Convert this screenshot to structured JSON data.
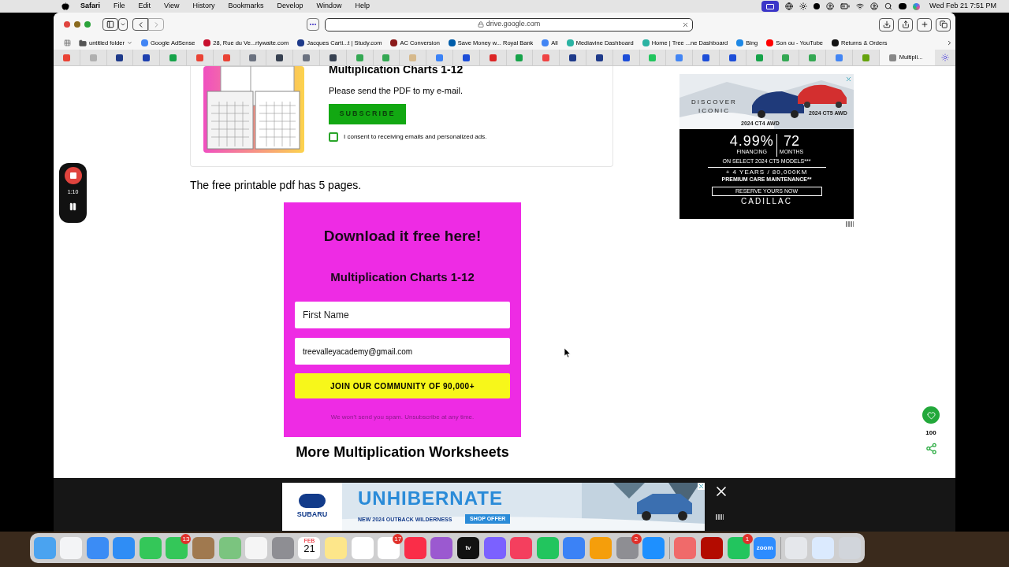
{
  "menu_bar": {
    "app": "Safari",
    "items": [
      "File",
      "Edit",
      "View",
      "History",
      "Bookmarks",
      "Develop",
      "Window",
      "Help"
    ],
    "clock": "Wed Feb 21  7:51 PM"
  },
  "toolbar": {
    "address": "drive.google.com"
  },
  "bookmarks": [
    {
      "label": "untitled folder",
      "kind": "folder",
      "color": "#555555"
    },
    {
      "label": "Google AdSense",
      "kind": "site",
      "color": "#4285f4"
    },
    {
      "label": "28, Rue du Ve...rtywaite.com",
      "kind": "site",
      "color": "#c8102e"
    },
    {
      "label": "Jacques Carti...t | Study.com",
      "kind": "site",
      "color": "#1e3a8a"
    },
    {
      "label": "AC Conversion",
      "kind": "site",
      "color": "#8b1a1a"
    },
    {
      "label": "Save Money w... Royal Bank",
      "kind": "site",
      "color": "#005daa"
    },
    {
      "label": "All",
      "kind": "site",
      "color": "#4285f4"
    },
    {
      "label": "Mediavine Dashboard",
      "kind": "site",
      "color": "#2bb3a3"
    },
    {
      "label": "Home | Tree ...ne Dashboard",
      "kind": "site",
      "color": "#2bb3a3"
    },
    {
      "label": "Bing",
      "kind": "site",
      "color": "#1e88e5"
    },
    {
      "label": "Son ou - YouTube",
      "kind": "site",
      "color": "#ff0000"
    },
    {
      "label": "Returns & Orders",
      "kind": "site",
      "color": "#111111"
    }
  ],
  "pinned_tabs": [
    {
      "color": "#ea4335"
    },
    {
      "color": "#b0b0b0"
    },
    {
      "color": "#1e3a8a"
    },
    {
      "color": "#1e40af"
    },
    {
      "color": "#16a34a"
    },
    {
      "color": "#ea4335"
    },
    {
      "color": "#ea4335"
    },
    {
      "color": "#6b7280"
    },
    {
      "color": "#374151"
    },
    {
      "color": "#6b7280"
    },
    {
      "color": "#374151"
    },
    {
      "color": "#34a853"
    },
    {
      "color": "#34a853"
    },
    {
      "color": "#d6b98c"
    },
    {
      "color": "#3b82f6"
    },
    {
      "color": "#1d4ed8"
    },
    {
      "color": "#dc2626"
    },
    {
      "color": "#16a34a"
    },
    {
      "color": "#ef4444"
    },
    {
      "color": "#1e3a8a"
    },
    {
      "color": "#1e3a8a"
    },
    {
      "color": "#1d4ed8"
    },
    {
      "color": "#22c55e"
    },
    {
      "color": "#4285f4"
    },
    {
      "color": "#1d4ed8"
    },
    {
      "color": "#1d4ed8"
    },
    {
      "color": "#16a34a"
    },
    {
      "color": "#34a853"
    },
    {
      "color": "#34a853"
    },
    {
      "color": "#4285f4"
    },
    {
      "color": "#65a30d"
    }
  ],
  "active_tab": {
    "label": "Multipli...",
    "selected": true
  },
  "recorder": {
    "time": "1:10"
  },
  "optin_card": {
    "title": "Multiplication Charts 1-12",
    "text": "Please send the PDF to my e-mail.",
    "button": "SUBSCRIBE",
    "consent": {
      "label": "I consent to receiving emails and personalized ads.",
      "checked": false
    }
  },
  "paragraph": "The free printable pdf has 5 pages.",
  "download_box": {
    "title": "Download it free here!",
    "subtitle": "Multiplication Charts 1-12",
    "name_field": {
      "placeholder": "First Name"
    },
    "email_field": {
      "value": "treevalleyacademy@gmail.com"
    },
    "button": "JOIN OUR COMMUNITY OF 90,000+",
    "note": "We won't send you spam. Unsubscribe at any time."
  },
  "section_heading": "More Multiplication Worksheets",
  "side_ad": {
    "headline": "DISCOVER ICONIC",
    "car_1": "2024 CT4 AWD",
    "car_2": "2024 CT5 AWD",
    "rate": "4.99%",
    "rate_label": "FINANCING",
    "term": "72",
    "term_label": "MONTHS",
    "fine_print": "ON SELECT 2024 CT5 MODELS***",
    "offer": "+ 4 YEARS / 80,000KM",
    "offer_sub": "PREMIUM CARE MAINTENANCE**",
    "cta": "RESERVE YOURS NOW",
    "brand": "CADILLAC"
  },
  "share": {
    "count": "100"
  },
  "bottom_ad": {
    "brand": "SUBARU",
    "headline": "UNHIBERNATE",
    "tagline": "NEW 2024 OUTBACK WILDERNESS",
    "cta": "SHOP OFFER"
  },
  "dock": [
    {
      "kind": "app",
      "color": "#4aa3f0"
    },
    {
      "kind": "app",
      "color": "#f3f4f6"
    },
    {
      "kind": "app",
      "color": "#3b8cf5"
    },
    {
      "kind": "app",
      "color": "#2f8df5"
    },
    {
      "kind": "app",
      "color": "#34c759"
    },
    {
      "kind": "app",
      "color": "#34c759",
      "badge": "13"
    },
    {
      "kind": "app",
      "color": "#a0794f"
    },
    {
      "kind": "app",
      "color": "#7bc47f"
    },
    {
      "kind": "app",
      "color": "#f5f5f5"
    },
    {
      "kind": "app",
      "color": "#8e8e93"
    },
    {
      "kind": "calendar",
      "month": "FEB",
      "day": "21"
    },
    {
      "kind": "app",
      "color": "#fde68a"
    },
    {
      "kind": "app",
      "color": "#ffffff"
    },
    {
      "kind": "app",
      "color": "#ffffff",
      "badge": "17"
    },
    {
      "kind": "app",
      "color": "#fa2d48"
    },
    {
      "kind": "app",
      "color": "#9b59d0"
    },
    {
      "kind": "app",
      "color": "#111111",
      "label": "tv"
    },
    {
      "kind": "app",
      "color": "#7b61ff"
    },
    {
      "kind": "app",
      "color": "#f43f5e"
    },
    {
      "kind": "app",
      "color": "#22c55e"
    },
    {
      "kind": "app",
      "color": "#3b82f6"
    },
    {
      "kind": "app",
      "color": "#f59e0b"
    },
    {
      "kind": "app",
      "color": "#8e8e93",
      "badge": "2"
    },
    {
      "kind": "app",
      "color": "#1e90ff"
    },
    {
      "kind": "separator"
    },
    {
      "kind": "app",
      "color": "#f06a6a"
    },
    {
      "kind": "app",
      "color": "#b30b00"
    },
    {
      "kind": "app",
      "color": "#22c55e",
      "badge": "1"
    },
    {
      "kind": "app",
      "color": "#2d8cff",
      "label": "zoom"
    },
    {
      "kind": "separator"
    },
    {
      "kind": "app",
      "color": "#e5e7eb"
    },
    {
      "kind": "app",
      "color": "#dbeafe"
    },
    {
      "kind": "app",
      "color": "#d1d5db"
    }
  ]
}
